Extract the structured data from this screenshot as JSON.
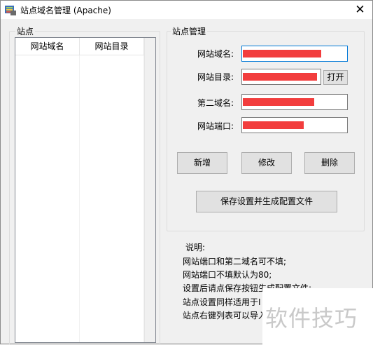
{
  "window": {
    "title": "站点域名管理 (Apache)",
    "close_glyph": "✕"
  },
  "sites": {
    "group_label": "站点",
    "columns": [
      "网站域名",
      "网站目录"
    ],
    "rows": []
  },
  "manage": {
    "group_label": "站点管理",
    "domain_label": "网站域名:",
    "dir_label": "网站目录:",
    "dir_open_button": "打开",
    "second_domain_label": "第二域名:",
    "port_label": "网站端口:",
    "add_button": "新增",
    "edit_button": "修改",
    "delete_button": "删除",
    "save_button": "保存设置并生成配置文件",
    "redact_color": "#f23d3d"
  },
  "notes": {
    "heading": "说明:",
    "lines": [
      "网站端口和第二域名可不填;",
      "网站端口不填默认为80;",
      "设置后请点保存按钮生成配置文件;",
      "站点设置同样适用于I",
      "站点右键列表可以导入"
    ]
  },
  "watermark": "软件技巧"
}
